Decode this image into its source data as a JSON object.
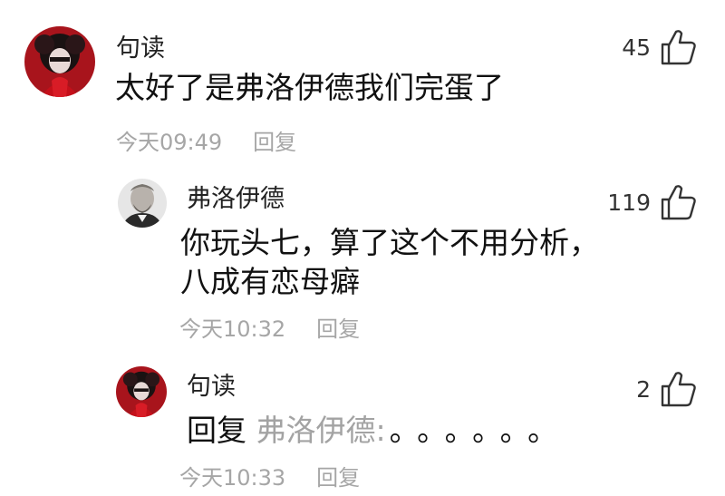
{
  "comments": [
    {
      "username": "句读",
      "text": "太好了是弗洛伊德我们完蛋了",
      "time": "今天09:49",
      "reply_label": "回复",
      "likes": "45",
      "avatar": "dark-anime-avatar"
    },
    {
      "username": "弗洛伊德",
      "text_line1": "你玩头七，算了这个不用分析，",
      "text_line2": "八成有恋母癖",
      "time": "今天10:32",
      "reply_label": "回复",
      "likes": "119",
      "avatar": "freud-portrait-avatar"
    },
    {
      "username": "句读",
      "reply_prefix": "回复",
      "reply_target": "弗洛伊德:",
      "reply_body": "。。。。。。",
      "time": "今天10:33",
      "reply_label": "回复",
      "likes": "2",
      "avatar": "dark-anime-avatar"
    }
  ],
  "icons": {
    "like": "thumbs-up-icon"
  },
  "colors": {
    "meta": "#a6a6a6",
    "avatar_red": "#a8141c"
  }
}
